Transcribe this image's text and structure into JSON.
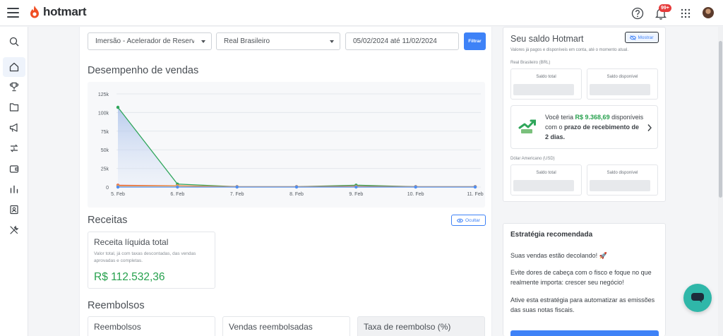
{
  "app": {
    "brand": "hotmart",
    "notifications_badge": "99+"
  },
  "sidebar": {
    "items": [
      {
        "name": "search-icon"
      },
      {
        "name": "home-icon",
        "active": true
      },
      {
        "name": "trophy-icon"
      },
      {
        "name": "folder-icon"
      },
      {
        "name": "megaphone-icon"
      },
      {
        "name": "money-exchange-icon"
      },
      {
        "name": "wallet-icon"
      },
      {
        "name": "bar-chart-icon"
      },
      {
        "name": "contact-card-icon"
      },
      {
        "name": "tools-icon"
      }
    ]
  },
  "filters": {
    "product": "Imersão - Acelerador de Reservas",
    "currency": "Real Brasileiro",
    "date_range": "05/02/2024 até 11/02/2024",
    "filter_button": "Filtrar"
  },
  "sales": {
    "title": "Desempenho de vendas"
  },
  "chart_data": {
    "type": "line",
    "categories": [
      "5. Feb",
      "6. Feb",
      "7. Feb",
      "8. Feb",
      "9. Feb",
      "10. Feb",
      "11. Feb"
    ],
    "y_ticks": [
      "125k",
      "100k",
      "75k",
      "50k",
      "25k",
      "0"
    ],
    "ylim": [
      0,
      125000
    ],
    "grid": true,
    "series": [
      {
        "color": "#2fa65a",
        "values": [
          107000,
          4000,
          500,
          500,
          2500,
          500,
          500
        ],
        "area": true
      },
      {
        "color": "#e05a4f",
        "values": [
          2500,
          1800,
          500,
          500,
          1000,
          500,
          500
        ]
      },
      {
        "color": "#f0a24a",
        "values": [
          1500,
          1500,
          300,
          300,
          600,
          300,
          300
        ]
      },
      {
        "color": "#4f8ef2",
        "values": [
          0,
          0,
          0,
          0,
          0,
          0,
          0
        ]
      }
    ]
  },
  "receitas": {
    "title": "Receitas",
    "hide_button": "Ocultar",
    "card": {
      "title": "Receita líquida total",
      "description": "Valor total, já com taxas descontadas, das vendas aprovadas e completas.",
      "value": "R$ 112.532,36"
    }
  },
  "reembolsos": {
    "title": "Reembolsos",
    "cards": [
      "Reembolsos",
      "Vendas reembolsadas",
      "Taxa de reembolso (%)"
    ]
  },
  "saldo": {
    "title": "Seu saldo Hotmart",
    "show_button": "Mostrar",
    "subtitle": "Valores já pagos e disponíveis em conta, até o momento atual.",
    "brl_label": "Real Brasileiro (BRL)",
    "usd_label": "Dólar Americano (USD)",
    "saldo_total": "Saldo total",
    "saldo_disponivel": "Saldo disponível",
    "promo": {
      "prefix": "Você teria ",
      "amount": "R$ 9.368,69",
      "middle": " disponíveis com o ",
      "bold": "prazo de recebimento de 2 dias."
    }
  },
  "estrategia": {
    "title": "Estratégia recomendada",
    "p1": "Suas vendas estão decolando! 🚀",
    "p2": "Evite dores de cabeça com o fisco e foque no que realmente importa: crescer seu negócio!",
    "p3": "Ative esta estratégia para automatizar as emissões das suas notas fiscais."
  }
}
